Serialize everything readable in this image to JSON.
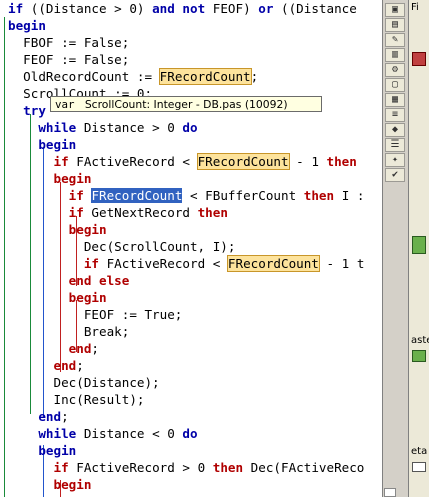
{
  "code_lines": [
    {
      "id": "l0",
      "segments": [
        {
          "t": "if",
          "c": "kwb"
        },
        {
          "t": " ((Distance > 0) "
        },
        {
          "t": "and",
          "c": "kwb"
        },
        {
          "t": " "
        },
        {
          "t": "not",
          "c": "kwb"
        },
        {
          "t": " FEOF) "
        },
        {
          "t": "or",
          "c": "kwb"
        },
        {
          "t": " ((Distance"
        }
      ]
    },
    {
      "id": "l1",
      "segments": [
        {
          "t": "begin",
          "c": "kwb"
        }
      ]
    },
    {
      "id": "l2",
      "segments": [
        {
          "t": "  FBOF := False;"
        }
      ]
    },
    {
      "id": "l3",
      "segments": [
        {
          "t": "  FEOF := False;"
        }
      ]
    },
    {
      "id": "l4",
      "segments": [
        {
          "t": "  OldRecordCount := "
        },
        {
          "t": "FRecordCount",
          "c": "hl"
        },
        {
          "t": ";"
        }
      ]
    },
    {
      "id": "l5",
      "segments": [
        {
          "t": "  ScrollCount := 0;"
        }
      ]
    },
    {
      "id": "l6",
      "segments": [
        {
          "t": "  "
        },
        {
          "t": "try",
          "c": "kwb"
        }
      ]
    },
    {
      "id": "l7",
      "segments": [
        {
          "t": "    "
        },
        {
          "t": "while",
          "c": "kwb"
        },
        {
          "t": " Distance > 0 "
        },
        {
          "t": "do",
          "c": "kwb"
        }
      ]
    },
    {
      "id": "l8",
      "segments": [
        {
          "t": "    "
        },
        {
          "t": "begin",
          "c": "kwb"
        }
      ]
    },
    {
      "id": "l9",
      "segments": [
        {
          "t": "      "
        },
        {
          "t": "if",
          "c": "kw"
        },
        {
          "t": " FActiveRecord < "
        },
        {
          "t": "FRecordCount",
          "c": "hl"
        },
        {
          "t": " - 1 "
        },
        {
          "t": "then",
          "c": "kw"
        }
      ]
    },
    {
      "id": "l10",
      "segments": [
        {
          "t": "      "
        },
        {
          "t": "begin",
          "c": "kw"
        }
      ]
    },
    {
      "id": "l11",
      "segments": [
        {
          "t": "        "
        },
        {
          "t": "if",
          "c": "kw"
        },
        {
          "t": " "
        },
        {
          "t": "FRecordCount",
          "c": "sel"
        },
        {
          "t": " < FBufferCount "
        },
        {
          "t": "then",
          "c": "kw"
        },
        {
          "t": " I :"
        }
      ]
    },
    {
      "id": "l12",
      "segments": [
        {
          "t": "        "
        },
        {
          "t": "if",
          "c": "kw"
        },
        {
          "t": " GetNextRecord "
        },
        {
          "t": "then",
          "c": "kw"
        }
      ]
    },
    {
      "id": "l13",
      "segments": [
        {
          "t": "        "
        },
        {
          "t": "begin",
          "c": "kw"
        }
      ]
    },
    {
      "id": "l14",
      "segments": [
        {
          "t": "          Dec(ScrollCount, I);"
        }
      ]
    },
    {
      "id": "l15",
      "segments": [
        {
          "t": "          "
        },
        {
          "t": "if",
          "c": "kw"
        },
        {
          "t": " FActiveRecord < "
        },
        {
          "t": "FRecordCount",
          "c": "hl"
        },
        {
          "t": " - 1 t"
        }
      ]
    },
    {
      "id": "l16",
      "segments": [
        {
          "t": "        "
        },
        {
          "t": "end",
          "c": "kw"
        },
        {
          "t": " "
        },
        {
          "t": "else",
          "c": "kw"
        }
      ]
    },
    {
      "id": "l17",
      "segments": [
        {
          "t": "        "
        },
        {
          "t": "begin",
          "c": "kw"
        }
      ]
    },
    {
      "id": "l18",
      "segments": [
        {
          "t": "          FEOF := True;"
        }
      ]
    },
    {
      "id": "l19",
      "segments": [
        {
          "t": "          Break;"
        }
      ]
    },
    {
      "id": "l20",
      "segments": [
        {
          "t": "        "
        },
        {
          "t": "end",
          "c": "kw"
        },
        {
          "t": ";"
        }
      ]
    },
    {
      "id": "l21",
      "segments": [
        {
          "t": "      "
        },
        {
          "t": "end",
          "c": "kw"
        },
        {
          "t": ";"
        }
      ]
    },
    {
      "id": "l22",
      "segments": [
        {
          "t": "      Dec(Distance);"
        }
      ]
    },
    {
      "id": "l23",
      "segments": [
        {
          "t": "      Inc(Result);"
        }
      ]
    },
    {
      "id": "l24",
      "segments": [
        {
          "t": "    "
        },
        {
          "t": "end",
          "c": "kwb"
        },
        {
          "t": ";"
        }
      ]
    },
    {
      "id": "l25",
      "segments": [
        {
          "t": "    "
        },
        {
          "t": "while",
          "c": "kwb"
        },
        {
          "t": " Distance < 0 "
        },
        {
          "t": "do",
          "c": "kwb"
        }
      ]
    },
    {
      "id": "l26",
      "segments": [
        {
          "t": "    "
        },
        {
          "t": "begin",
          "c": "kwb"
        }
      ]
    },
    {
      "id": "l27",
      "segments": [
        {
          "t": "      "
        },
        {
          "t": "if",
          "c": "kw"
        },
        {
          "t": " FActiveRecord > 0 "
        },
        {
          "t": "then",
          "c": "kw"
        },
        {
          "t": " Dec(FActiveReco"
        }
      ]
    },
    {
      "id": "l28",
      "segments": [
        {
          "t": "      "
        },
        {
          "t": "begin",
          "c": "kw"
        }
      ]
    }
  ],
  "tooltip": {
    "kind": "var",
    "text": "ScrollCount: Integer - DB.pas (10092)"
  },
  "toolbar": {
    "icons": [
      "form-icon",
      "folder-icon",
      "palette-icon",
      "lock-icon",
      "component-icon",
      "window-icon",
      "grid-icon",
      "list-icon",
      "highlight-icon",
      "options-icon",
      "wand-icon",
      "check-icon"
    ]
  },
  "right_panel": {
    "top_label": "Fi",
    "mid_label": "aste",
    "bottom_label": "eta"
  },
  "colors": {
    "keyword_red": "#b00000",
    "keyword_blue": "#0000a8",
    "highlight": "#fde39c",
    "selection": "#3162c0",
    "tooltip_bg": "#ffffe1"
  }
}
